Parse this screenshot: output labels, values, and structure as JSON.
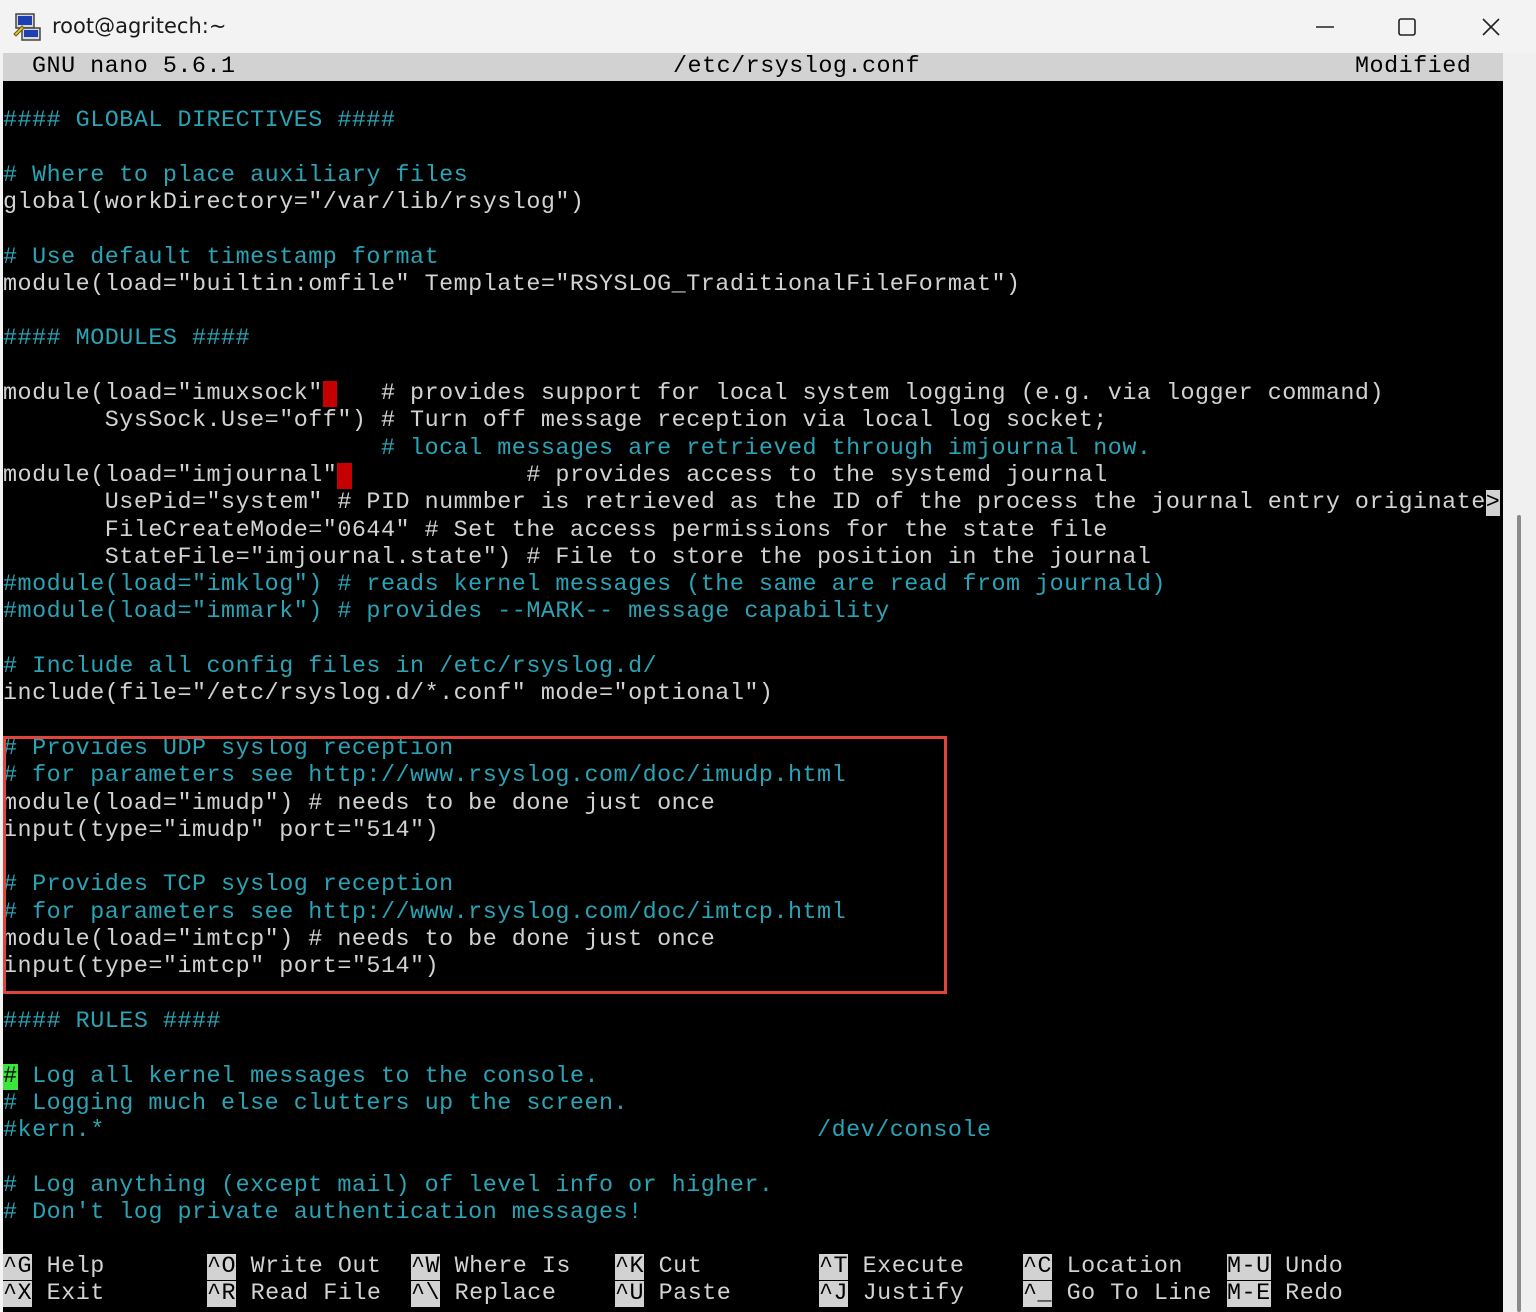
{
  "window": {
    "title": "root@agritech:~",
    "icon": "putty-icon",
    "controls": [
      "minimize-icon",
      "maximize-icon",
      "close-icon"
    ]
  },
  "nano": {
    "version": "GNU nano 5.6.1",
    "filename": "/etc/rsyslog.conf",
    "status": "Modified"
  },
  "lines": [
    [
      [
        "c",
        "#### GLOBAL DIRECTIVES ####"
      ]
    ],
    [],
    [
      [
        "c",
        "# Where to place auxiliary files"
      ]
    ],
    [
      [
        "w",
        "global(workDirectory=\"/var/lib/rsyslog\")"
      ]
    ],
    [],
    [
      [
        "c",
        "# Use default timestamp format"
      ]
    ],
    [
      [
        "w",
        "module(load=\"builtin:omfile\" Template=\"RSYSLOG_TraditionalFileFormat\")"
      ]
    ],
    [],
    [
      [
        "c",
        "#### MODULES ####"
      ]
    ],
    [],
    [
      [
        "w",
        "module(load=\"imuxsock\""
      ],
      [
        "mark",
        " "
      ],
      [
        "w",
        "   # provides support for local system logging (e.g. via logger command)"
      ]
    ],
    [
      [
        "w",
        "       SysSock.Use=\"off\") # Turn off message reception via local log socket;"
      ]
    ],
    [
      [
        "w",
        "                          "
      ],
      [
        "c",
        "# local messages are retrieved through imjournal now."
      ]
    ],
    [
      [
        "w",
        "module(load=\"imjournal\""
      ],
      [
        "mark",
        " "
      ],
      [
        "w",
        "            # provides access to the systemd journal"
      ]
    ],
    [
      [
        "w",
        "       UsePid=\"system\" # PID nummber is retrieved as the ID of the process the journal entry originate"
      ],
      [
        "more",
        ">"
      ]
    ],
    [
      [
        "w",
        "       FileCreateMode=\"0644\" # Set the access permissions for the state file"
      ]
    ],
    [
      [
        "w",
        "       StateFile=\"imjournal.state\") # File to store the position in the journal"
      ]
    ],
    [
      [
        "c",
        "#module(load=\"imklog\") # reads kernel messages (the same are read from journald)"
      ]
    ],
    [
      [
        "c",
        "#module(load=\"immark\") # provides --MARK-- message capability"
      ]
    ],
    [],
    [
      [
        "c",
        "# Include all config files in /etc/rsyslog.d/"
      ]
    ],
    [
      [
        "w",
        "include(file=\"/etc/rsyslog.d/*.conf\" mode=\"optional\")"
      ]
    ],
    [],
    [
      [
        "c",
        "# Provides UDP syslog reception"
      ]
    ],
    [
      [
        "c",
        "# for parameters see http://www.rsyslog.com/doc/imudp.html"
      ]
    ],
    [
      [
        "w",
        "module(load=\"imudp\") # needs to be done just once"
      ]
    ],
    [
      [
        "w",
        "input(type=\"imudp\" port=\"514\")"
      ]
    ],
    [],
    [
      [
        "c",
        "# Provides TCP syslog reception"
      ]
    ],
    [
      [
        "c",
        "# for parameters see http://www.rsyslog.com/doc/imtcp.html"
      ]
    ],
    [
      [
        "w",
        "module(load=\"imtcp\") # needs to be done just once"
      ]
    ],
    [
      [
        "w",
        "input(type=\"imtcp\" port=\"514\")"
      ]
    ],
    [],
    [
      [
        "c",
        "#### RULES ####"
      ]
    ],
    [],
    [
      [
        "cursor",
        "#"
      ],
      [
        "c",
        " Log all kernel messages to the console."
      ]
    ],
    [
      [
        "c",
        "# Logging much else clutters up the screen."
      ]
    ],
    [
      [
        "c",
        "#kern.*                                                 /dev/console"
      ]
    ],
    [],
    [
      [
        "c",
        "# Log anything (except mail) of level info or higher."
      ]
    ],
    [
      [
        "c",
        "# Don't log private authentication messages!"
      ]
    ]
  ],
  "shortcuts": [
    {
      "key": "^G",
      "label": "Help"
    },
    {
      "key": "^X",
      "label": "Exit"
    },
    {
      "key": "^O",
      "label": "Write Out"
    },
    {
      "key": "^R",
      "label": "Read File"
    },
    {
      "key": "^W",
      "label": "Where Is"
    },
    {
      "key": "^\\",
      "label": "Replace"
    },
    {
      "key": "^K",
      "label": "Cut"
    },
    {
      "key": "^U",
      "label": "Paste"
    },
    {
      "key": "^T",
      "label": "Execute"
    },
    {
      "key": "^J",
      "label": "Justify"
    },
    {
      "key": "^C",
      "label": "Location"
    },
    {
      "key": "^_",
      "label": "Go To Line"
    },
    {
      "key": "M-U",
      "label": "Undo"
    },
    {
      "key": "M-E",
      "label": "Redo"
    }
  ],
  "colors": {
    "terminal_bg": "#000000",
    "text": "#d2d2d2",
    "comment": "#2aa3b5",
    "mark": "#c40000",
    "cursor": "#39e639",
    "highlight_box": "#e0453d"
  }
}
